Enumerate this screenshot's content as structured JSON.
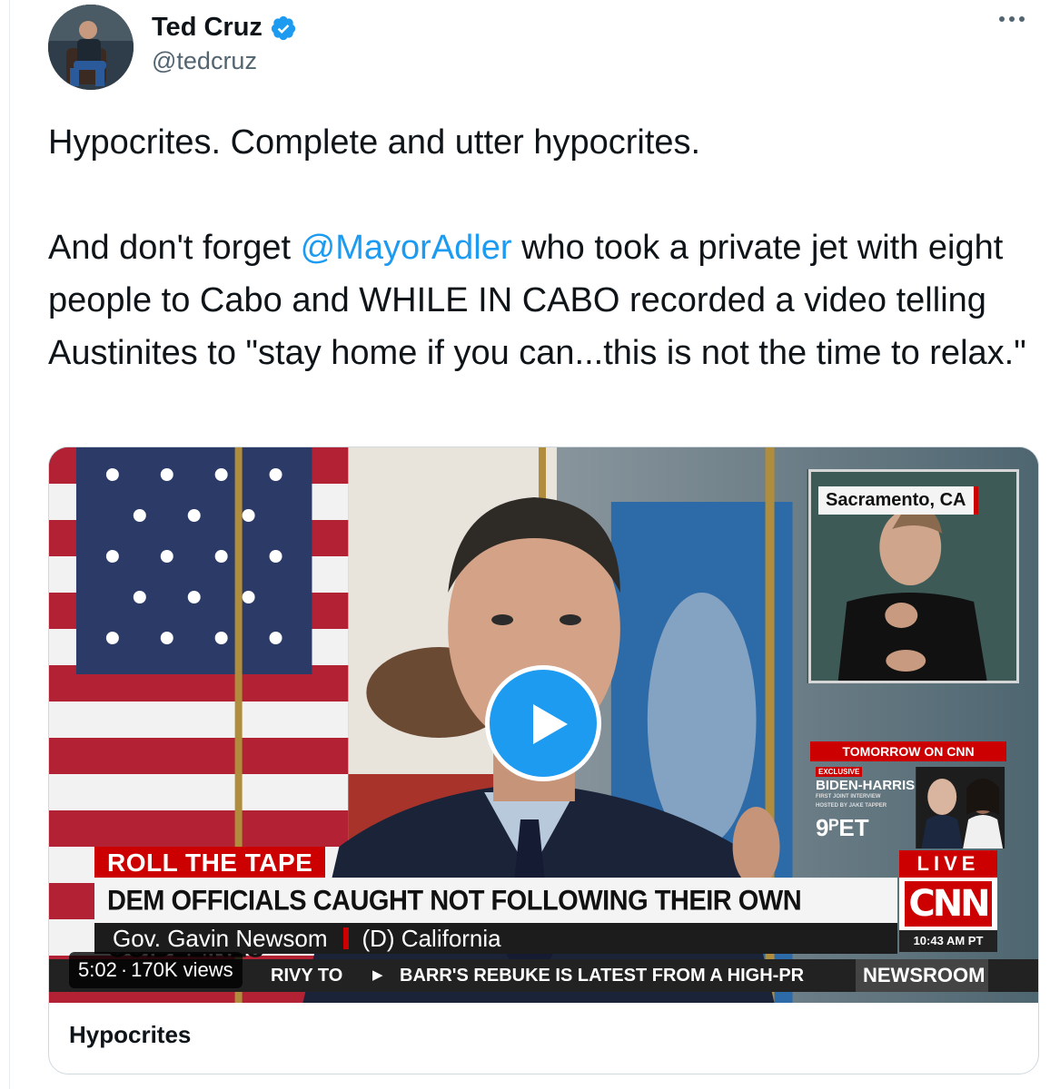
{
  "tweet": {
    "author": {
      "display_name": "Ted Cruz",
      "handle": "@tedcruz",
      "verified": true
    },
    "text_line1": "Hypocrites. Complete and utter hypocrites.",
    "text_line2_pre": "And don't forget ",
    "text_mention": "@MayorAdler",
    "text_line2_post": " who took a private jet with eight people to Cabo and WHILE IN CABO recorded a video telling Austinites to \"stay home if you can...this is not the time to relax.\""
  },
  "media": {
    "title": "Hypocrites",
    "duration": "5:02",
    "views": "170K views",
    "overlay": {
      "inset_location": "Sacramento, CA",
      "promo_header": "TOMORROW ON CNN",
      "promo_exclusive": "EXCLUSIVE",
      "promo_title": "BIDEN-HARRIS",
      "promo_subtitle": "FIRST JOINT INTERVIEW",
      "promo_host": "HOSTED BY JAKE TAPPER",
      "promo_time": "9ᴾET",
      "live_label": "LIVE",
      "network": "CNN",
      "clock": "10:43 AM PT",
      "segment": "ROLL THE TAPE",
      "headline": "DEM OFFICIALS CAUGHT NOT FOLLOWING THEIR OWN GUIDELINES",
      "speaker": "Gov. Gavin Newsom",
      "speaker_detail": "(D) California",
      "ticker_a": "RIVY TO",
      "ticker_b": "BARR'S REBUKE IS LATEST FROM A HIGH-PR",
      "ticker_show": "NEWSROOM"
    }
  },
  "colors": {
    "accent": "#1d9bf0",
    "text": "#0f1419",
    "muted": "#536471",
    "cnn_red": "#cc0000"
  },
  "icons": {
    "verified": "verified-badge-icon",
    "more": "more-horizontal-icon",
    "play": "play-icon"
  }
}
